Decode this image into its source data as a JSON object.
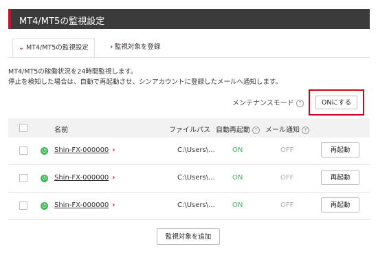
{
  "header": {
    "title": "MT4/MT5の監視設定"
  },
  "tabs": [
    {
      "label": "MT4/MT5の監視設定",
      "active": true
    },
    {
      "label": "監視対象を登録",
      "active": false
    }
  ],
  "description": {
    "line1": "MT4/MT5の稼働状況を24時間監視します。",
    "line2": "停止を検知した場合は、自動で再起動させ、シンアカウントに登録したメールへ通知します。"
  },
  "maintenance": {
    "label": "メンテナンスモード",
    "help": "?",
    "button": "ONにする"
  },
  "table": {
    "headers": {
      "name": "名前",
      "path": "ファイルパス",
      "auto_restart": "自動再起動",
      "mail": "メール通知",
      "help": "?"
    },
    "rows": [
      {
        "name": "Shin-FX-000000",
        "path": "C:\\Users\\...",
        "auto_restart": "ON",
        "mail": "OFF",
        "action": "再起動"
      },
      {
        "name": "Shin-FX-000000",
        "path": "C:\\Users\\...",
        "auto_restart": "ON",
        "mail": "OFF",
        "action": "再起動"
      },
      {
        "name": "Shin-FX-000000",
        "path": "C:\\Users\\...",
        "auto_restart": "ON",
        "mail": "OFF",
        "action": "再起動"
      }
    ]
  },
  "footer": {
    "add_button": "監視対象を追加"
  },
  "colors": {
    "accent": "#c8102e",
    "header_bg": "#3b3b3b",
    "status_on": "#3cba54"
  }
}
